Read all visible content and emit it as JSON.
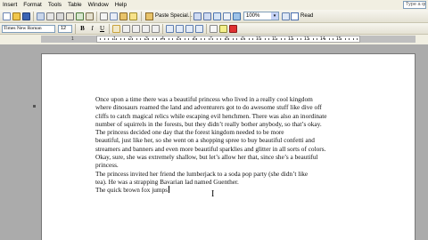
{
  "menu": [
    "Insert",
    "Format",
    "Tools",
    "Table",
    "Window",
    "Help"
  ],
  "help_box": "Type a question",
  "toolbar": {
    "paste_special": "Paste Special...",
    "zoom": "100%",
    "read": "Read"
  },
  "format_bar": {
    "font": "Times New Roman",
    "size": "12",
    "bold": "B",
    "italic": "I",
    "underline": "U"
  },
  "ruler": {
    "numbers": [
      "1",
      "1",
      "2",
      "3",
      "4",
      "5",
      "6",
      "7",
      "8",
      "9",
      "10",
      "11",
      "12",
      "13",
      "14",
      "15"
    ]
  },
  "document": {
    "lines": [
      "Once upon a time there was a beautiful princess who lived in a really cool kingdom",
      "where dinosaurs roamed the land and adventurers got to do awesome stuff like dive off",
      "cliffs to catch magical relics while escaping evil henchmen.  There was also an inordinate",
      "number of squirrels in the forests, but they didn’t really bother anybody, so that’s okay.",
      "        The princess decided one day that the forest kingdom needed to be more",
      "beautiful, just like her, so she went on a shopping spree to buy beautiful confetti and",
      "streamers and banners and even more beautiful sparklies and glitter in all sorts of colors.",
      "Okay, sure, she was extremely shallow, but let’s allow her that, since she’s a beautiful",
      "princess.",
      "        The princess invited her friend the lumberjack to a soda pop party (she didn’t like",
      "tea).  He was a strapping Bavarian lad named Guenther.",
      "        The quick brown fox jumps"
    ]
  }
}
